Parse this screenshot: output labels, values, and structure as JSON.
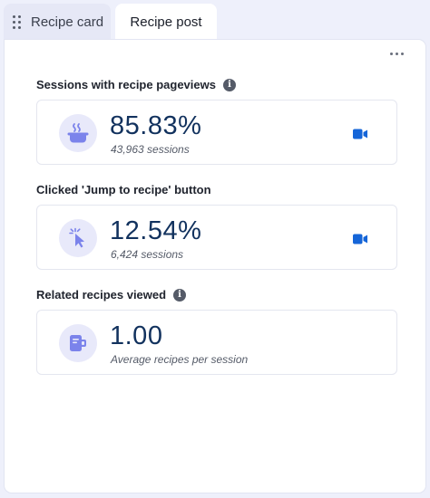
{
  "tabs": [
    {
      "label": "Recipe card",
      "active": false
    },
    {
      "label": "Recipe post",
      "active": true
    }
  ],
  "metrics": [
    {
      "title": "Sessions with recipe pageviews",
      "value": "85.83%",
      "subtitle": "43,963 sessions",
      "icon": "cooking-pot-icon",
      "has_info": true,
      "has_video": true
    },
    {
      "title": "Clicked 'Jump to recipe' button",
      "value": "12.54%",
      "subtitle": "6,424 sessions",
      "icon": "pointer-click-icon",
      "has_info": false,
      "has_video": true
    },
    {
      "title": "Related recipes viewed",
      "value": "1.00",
      "subtitle": "Average recipes per session",
      "icon": "recipe-book-icon",
      "has_info": true,
      "has_video": false
    }
  ],
  "info_glyph": "i",
  "colors": {
    "accent": "#1565d8",
    "value": "#12325e",
    "icon_fill": "#7b83eb",
    "icon_bg": "#e8e9fa"
  }
}
